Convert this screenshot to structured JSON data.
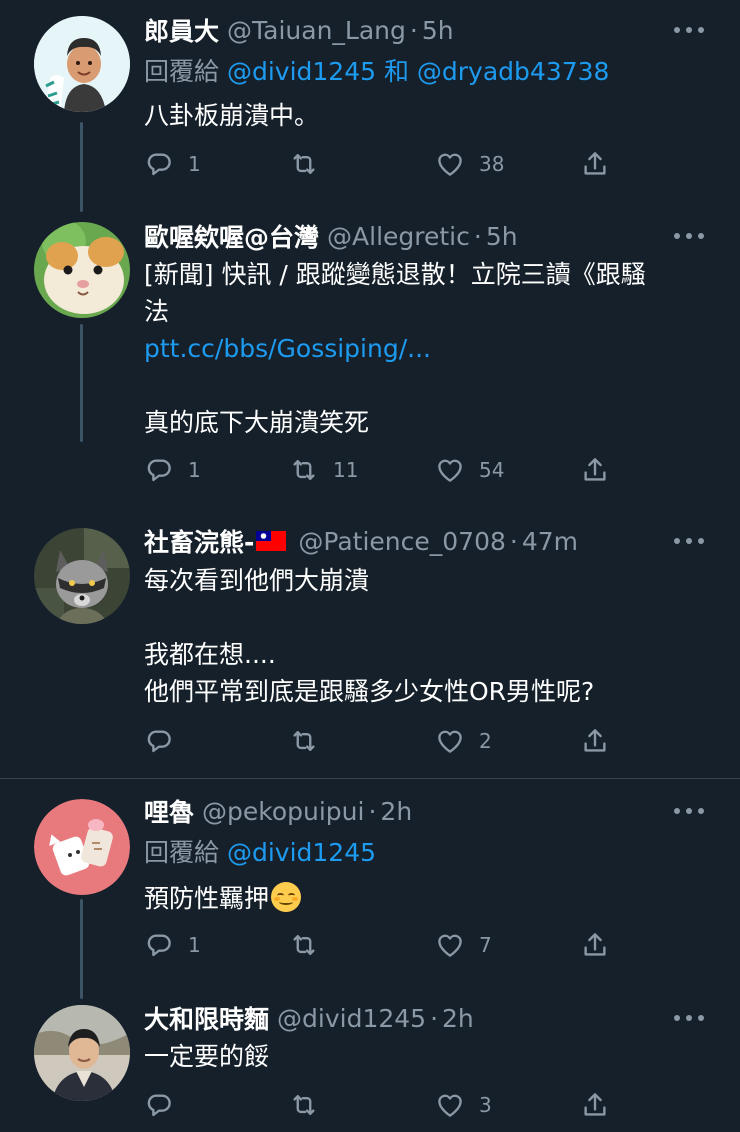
{
  "tweets": [
    {
      "name": "郎員大",
      "handle": "@Taiuan_Lang",
      "time": "5h",
      "reply_prefix": "回覆給",
      "reply_mentions": "@divid1245 和 @dryadb43738",
      "lines": [
        "八卦板崩潰中。"
      ],
      "replies": "1",
      "retweets": "",
      "likes": "38",
      "avatar_icon": "memoji-avatar"
    },
    {
      "name": "歐喔欸喔@台灣",
      "handle": "@Allegretic",
      "time": "5h",
      "lines": [
        "[新聞] 快訊 / 跟蹤變態退散！立院三讀《跟騷",
        "法"
      ],
      "link": "ptt.cc/bbs/Gossiping/...",
      "after_link": "真的底下大崩潰笑死",
      "replies": "1",
      "retweets": "11",
      "likes": "54",
      "avatar_icon": "hamster-avatar"
    },
    {
      "name": "社畜浣熊-",
      "flag_icon": "taiwan-flag-icon",
      "handle": "@Patience_0708",
      "time": "47m",
      "lines": [
        "每次看到他們大崩潰",
        "",
        "我都在想....",
        "他們平常到底是跟騷多少女性OR男性呢?"
      ],
      "replies": "",
      "retweets": "",
      "likes": "2",
      "avatar_icon": "raccoon-avatar"
    },
    {
      "name": "哩魯",
      "handle": "@pekopuipui",
      "time": "2h",
      "reply_prefix": "回覆給",
      "reply_mentions": "@divid1245",
      "text": "預防性羈押",
      "emoji": "relieved-face-emoji",
      "replies": "1",
      "retweets": "",
      "likes": "7",
      "avatar_icon": "cat-cup-avatar"
    },
    {
      "name": "大和限時麵",
      "handle": "@divid1245",
      "time": "2h",
      "lines": [
        "一定要的餒"
      ],
      "replies": "",
      "retweets": "",
      "likes": "3",
      "avatar_icon": "person-photo-avatar"
    }
  ],
  "dot": "·",
  "colors": {
    "background": "#15202b",
    "link": "#1d9bf0",
    "secondary_text": "#8b98a5",
    "thread_line": "#3d5466"
  }
}
